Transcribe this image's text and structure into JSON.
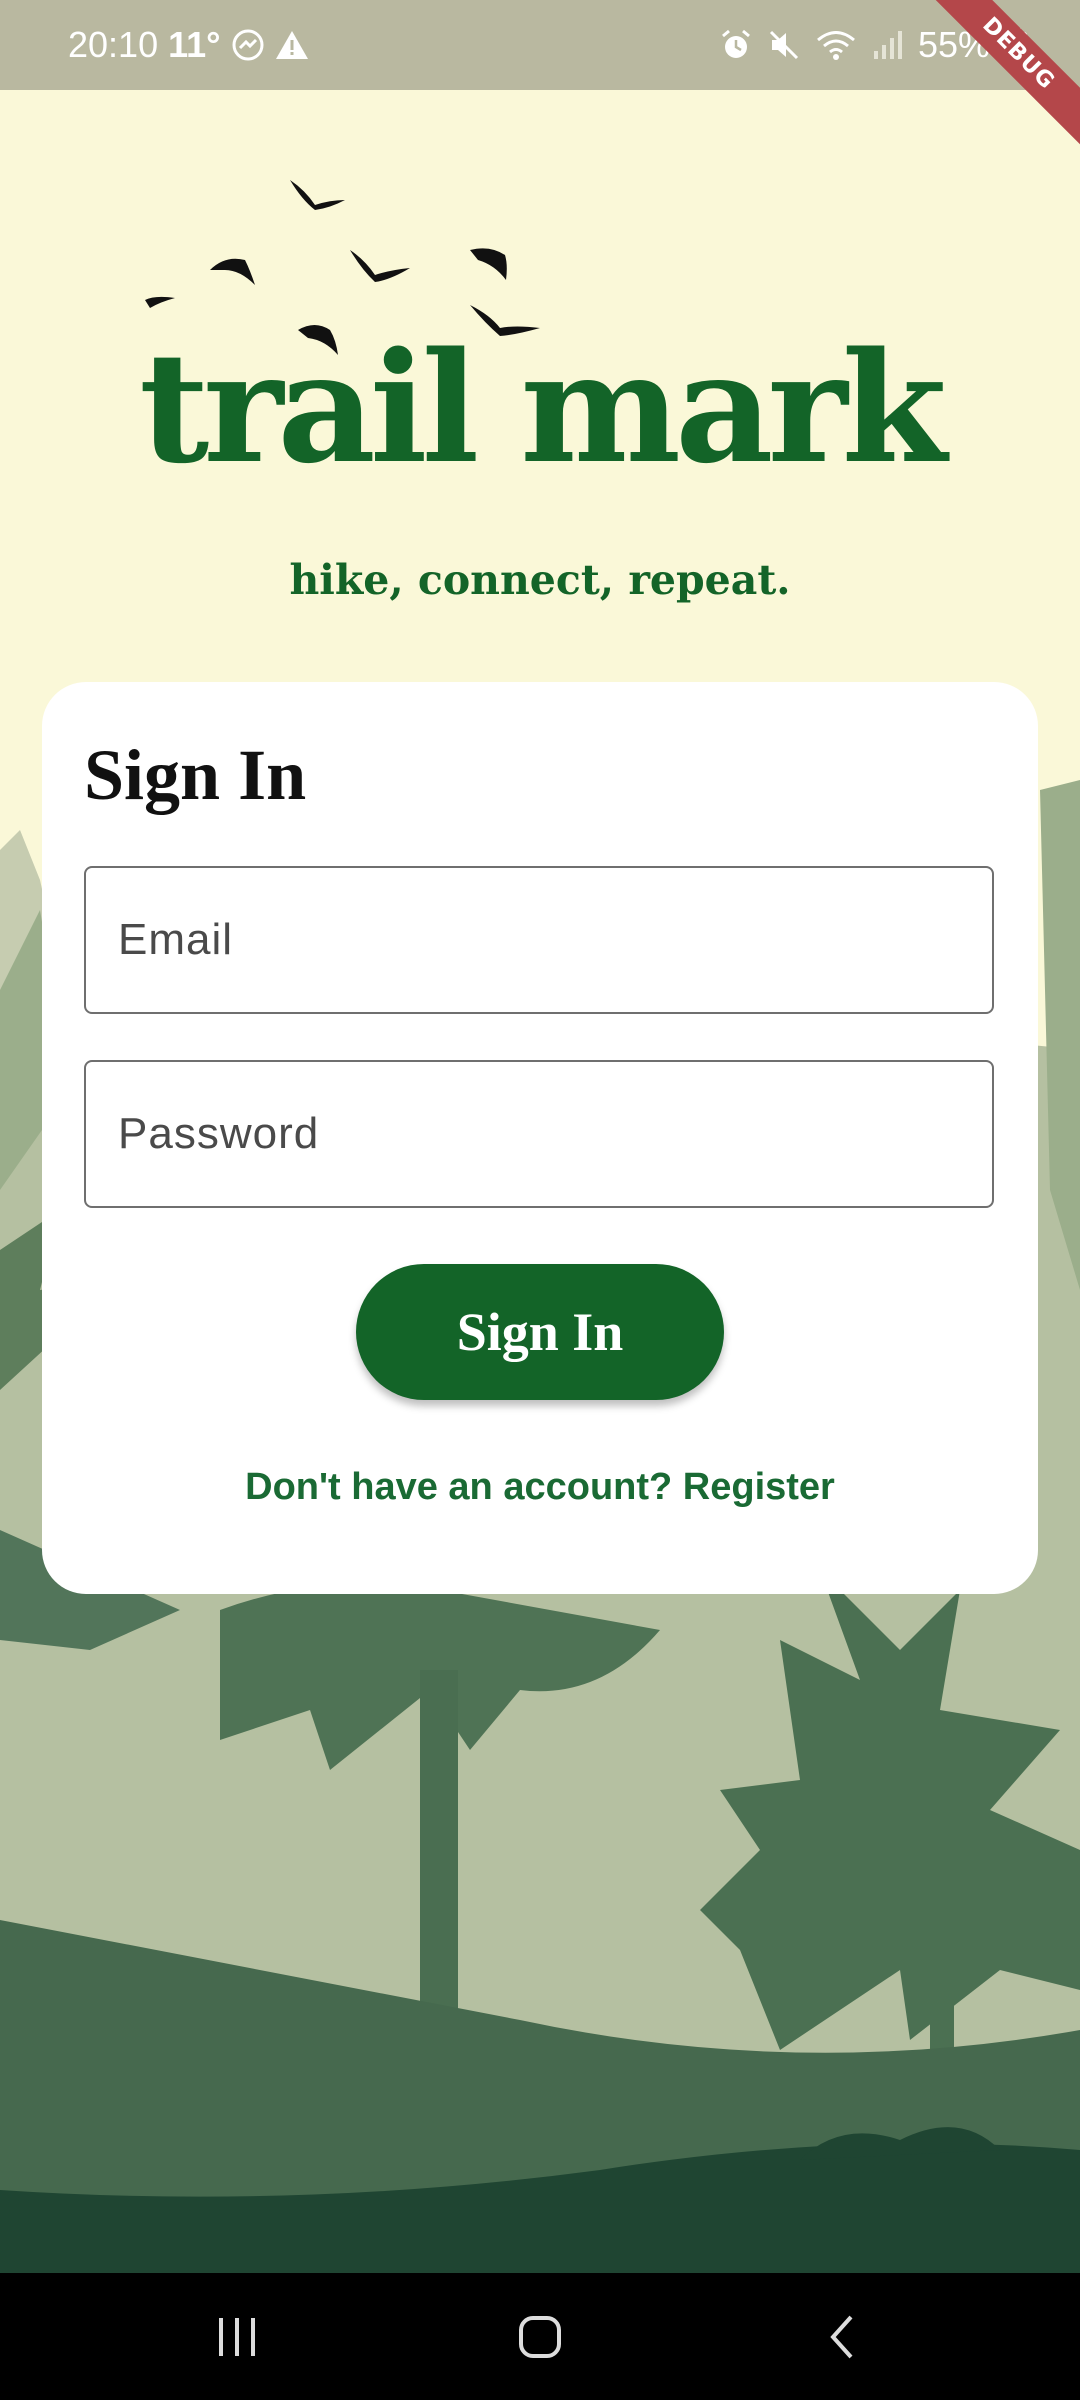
{
  "status_bar": {
    "time": "20:10",
    "temperature": "11°",
    "battery": "55%"
  },
  "debug_banner": "DEBUG",
  "logo": {
    "title": "trail mark",
    "tagline": "hike, connect, repeat."
  },
  "signin_card": {
    "title": "Sign In",
    "email_placeholder": "Email",
    "password_placeholder": "Password",
    "submit_label": "Sign In",
    "register_text": "Don't have an account? Register"
  },
  "colors": {
    "brand_green": "#136428",
    "background": "#faf8d8"
  },
  "icons": [
    "weather-icon",
    "messenger-icon",
    "warning-icon",
    "alarm-icon",
    "mute-icon",
    "wifi-icon",
    "signal-icon",
    "battery-icon",
    "recent-apps-icon",
    "home-icon",
    "back-icon"
  ]
}
